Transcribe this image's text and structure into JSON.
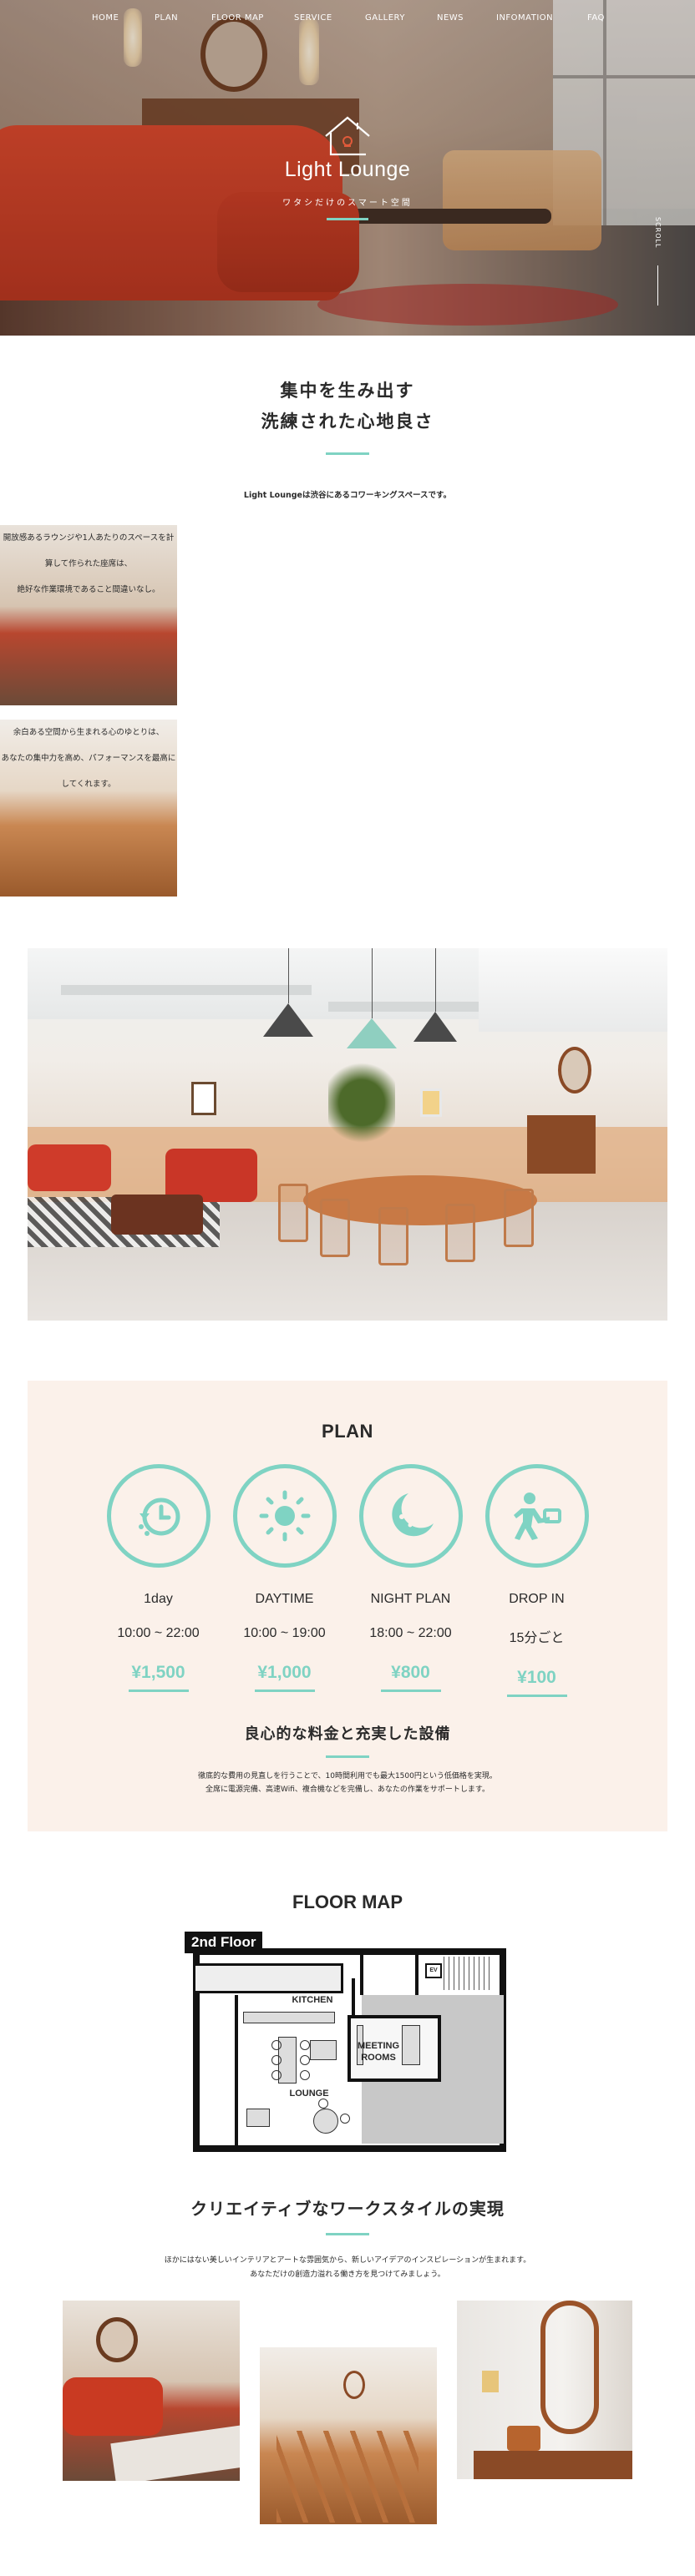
{
  "nav": [
    "HOME",
    "PLAN",
    "FLOOR MAP",
    "SERVICE",
    "GALLERY",
    "NEWS",
    "INFOMATION",
    "FAQ"
  ],
  "brand": {
    "name": "Light Lounge",
    "tagline": "ワタシだけのスマート空間"
  },
  "scroll_label": "SCROLL",
  "intro": {
    "title_line1": "集中を生み出す",
    "title_line2": "洗練された心地良さ",
    "lead": "Light Loungeは渋谷にあるコワーキングスペースです。",
    "p1": "開放感あるラウンジや1人あたりのスペースを計算して作られた座席は、",
    "p2": "絶好な作業環境であること間違いなし。",
    "p3": "余白ある空間から生まれる心のゆとりは、",
    "p4": "あなたの集中力を高め、パフォーマンスを最高にしてくれます。"
  },
  "plan": {
    "title": "PLAN",
    "items": [
      {
        "name": "1day",
        "time": "10:00 ~ 22:00",
        "price": "¥1,500",
        "icon": "clock-icon"
      },
      {
        "name": "DAYTIME",
        "time": "10:00 ~ 19:00",
        "price": "¥1,000",
        "icon": "sun-icon"
      },
      {
        "name": "NIGHT PLAN",
        "time": "18:00 ~ 22:00",
        "price": "¥800",
        "icon": "moon-icon"
      },
      {
        "name": "DROP IN",
        "time": "15分ごと",
        "price": "¥100",
        "icon": "person-icon"
      }
    ],
    "subtitle": "良心的な料金と充実した設備",
    "desc1": "徹底的な費用の見直しを行うことで、10時間利用でも最大1500円という低価格を実現。",
    "desc2": "全席に電源完備、高速Wifi、複合機などを完備し、あなたの作業をサポートします。"
  },
  "floormap": {
    "title": "FLOOR MAP",
    "floor_tag": "2nd Floor",
    "kitchen": "KITCHEN",
    "lounge": "LOUNGE",
    "meeting_line1": "MEETING",
    "meeting_line2": "ROOMS",
    "ev": "EV"
  },
  "creative": {
    "title": "クリエイティブなワークスタイルの実現",
    "desc1": "ほかにはない美しいインテリアとアートな雰囲気から、新しいアイデアのインスピレーションが生まれます。",
    "desc2": "あなただけの創造力溢れる働き方を見つけてみましょう。"
  },
  "colors": {
    "accent": "#7fd3c3",
    "plan_bg": "#fbf1ea",
    "sofa_red": "#d9452a"
  }
}
